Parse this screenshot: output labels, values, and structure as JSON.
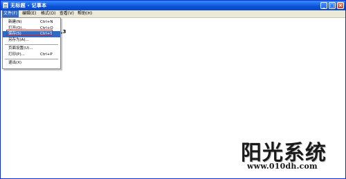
{
  "window": {
    "title": "无标题 - 记事本",
    "controls": {
      "minimize": "_",
      "maximize": "□",
      "close": "×"
    }
  },
  "menubar": {
    "items": [
      {
        "label": "文件(F)",
        "active": true
      },
      {
        "label": "编辑(E)"
      },
      {
        "label": "格式(O)"
      },
      {
        "label": "查看(V)"
      },
      {
        "label": "帮助(H)"
      }
    ]
  },
  "file_menu": {
    "items": [
      {
        "label": "新建(N)",
        "shortcut": "Ctrl+N"
      },
      {
        "label": "打开(O)...",
        "shortcut": "Ctrl+O"
      },
      {
        "label": "保存(S)",
        "shortcut": "Ctrl+S",
        "highlighted": true
      },
      {
        "label": "另存为(A)..."
      },
      {
        "label": "页面设置(U)..."
      },
      {
        "label": "打印(P)...",
        "shortcut": "Ctrl+P"
      },
      {
        "label": "退出(X)"
      }
    ]
  },
  "editor": {
    "text": ",3"
  },
  "watermark": {
    "title": "阳光系统",
    "url": "www.010dh.com"
  },
  "colors": {
    "titlebar": "#0a52d8",
    "menu_highlight": "#316ac5",
    "annotation_box": "#e21b1b"
  }
}
